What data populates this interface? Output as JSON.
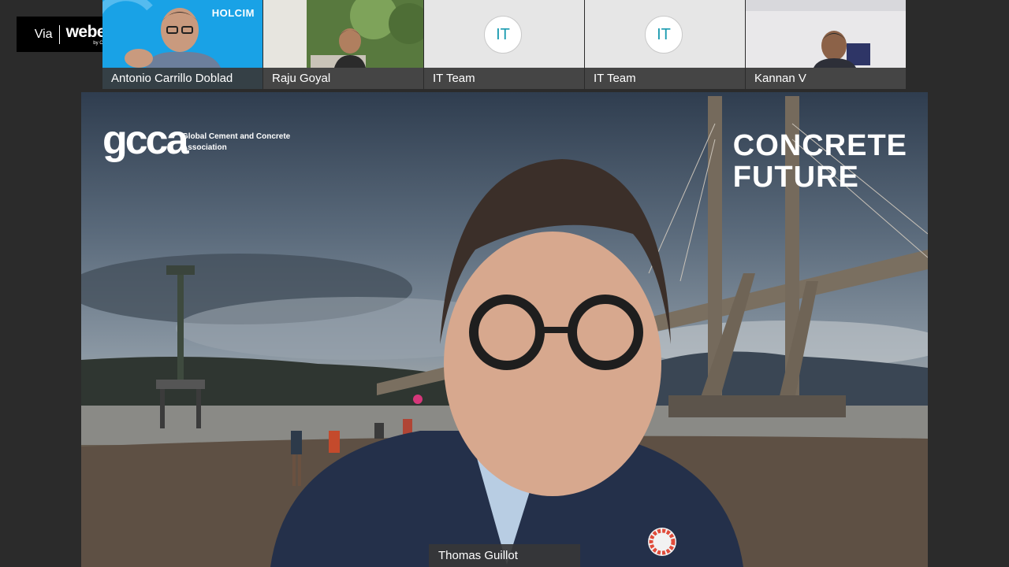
{
  "brand": {
    "via": "Via",
    "name": "webex",
    "by": "by CISCO"
  },
  "participants": [
    {
      "name": "Antonio Carrillo Doblad",
      "type": "video",
      "logo": "HOLCIM"
    },
    {
      "name": "Raju Goyal",
      "type": "video"
    },
    {
      "name": "IT Team",
      "type": "avatar",
      "initials": "IT"
    },
    {
      "name": "IT Team",
      "type": "avatar",
      "initials": "IT"
    },
    {
      "name": "Kannan V",
      "type": "video"
    }
  ],
  "stage": {
    "speaker_name": "Thomas Guillot",
    "org_mark": "gcca",
    "org_name": "Global Cement and Concrete Association",
    "campaign_line1": "CONCRETE",
    "campaign_line2": "FUTURE"
  },
  "colors": {
    "background": "#2b2b2b",
    "nameplate": "#373737",
    "holcim_blue": "#1aa3e8",
    "avatar_text": "#1a9bb0"
  }
}
